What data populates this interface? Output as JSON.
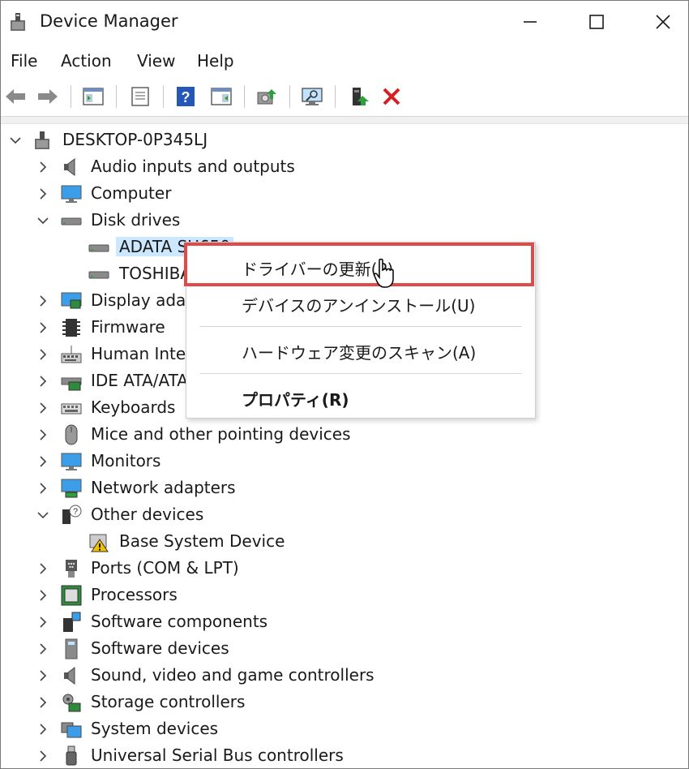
{
  "window": {
    "title": "Device Manager"
  },
  "menu": [
    "File",
    "Action",
    "View",
    "Help"
  ],
  "toolbar": [
    "back-arrow-icon",
    "forward-arrow-icon",
    "show-hide-console-tree-icon",
    "properties-icon",
    "help-icon",
    "action-pane-icon",
    "update-driver-icon",
    "scan-hardware-icon",
    "enable-device-icon",
    "uninstall-device-icon"
  ],
  "tree": {
    "root": "DESKTOP-0P345LJ",
    "items": [
      {
        "label": "Audio inputs and outputs",
        "expanded": false,
        "icon": "speaker-icon"
      },
      {
        "label": "Computer",
        "expanded": false,
        "icon": "monitor-icon"
      },
      {
        "label": "Disk drives",
        "expanded": true,
        "icon": "disk-drive-icon"
      },
      {
        "label": "ADATA SU650",
        "child": true,
        "selected": true,
        "icon": "disk-drive-icon"
      },
      {
        "label": "TOSHIBA",
        "child": true,
        "icon": "disk-drive-icon"
      },
      {
        "label": "Display adapters",
        "expanded": false,
        "icon": "display-adapter-icon"
      },
      {
        "label": "Firmware",
        "expanded": false,
        "icon": "firmware-chip-icon"
      },
      {
        "label": "Human Interface Devices",
        "expanded": false,
        "icon": "keyboard-hid-icon"
      },
      {
        "label": "IDE ATA/ATAPI controllers",
        "expanded": false,
        "icon": "ide-controller-icon"
      },
      {
        "label": "Keyboards",
        "expanded": false,
        "icon": "keyboard-icon"
      },
      {
        "label": "Mice and other pointing devices",
        "expanded": false,
        "icon": "mouse-icon"
      },
      {
        "label": "Monitors",
        "expanded": false,
        "icon": "monitor-icon"
      },
      {
        "label": "Network adapters",
        "expanded": false,
        "icon": "network-adapter-icon"
      },
      {
        "label": "Other devices",
        "expanded": true,
        "icon": "unknown-device-icon"
      },
      {
        "label": "Base System Device",
        "child": true,
        "icon": "warning-device-icon"
      },
      {
        "label": "Ports (COM & LPT)",
        "expanded": false,
        "icon": "port-icon"
      },
      {
        "label": "Processors",
        "expanded": false,
        "icon": "processor-icon"
      },
      {
        "label": "Software components",
        "expanded": false,
        "icon": "software-component-icon"
      },
      {
        "label": "Software devices",
        "expanded": false,
        "icon": "software-device-icon"
      },
      {
        "label": "Sound, video and game controllers",
        "expanded": false,
        "icon": "speaker-icon"
      },
      {
        "label": "Storage controllers",
        "expanded": false,
        "icon": "storage-controller-icon"
      },
      {
        "label": "System devices",
        "expanded": false,
        "icon": "system-device-icon"
      },
      {
        "label": "Universal Serial Bus controllers",
        "expanded": false,
        "icon": "usb-icon"
      }
    ]
  },
  "context_menu": {
    "items": [
      {
        "label": "ドライバーの更新(P)",
        "highlighted": true
      },
      {
        "label": "デバイスのアンインストール(U)"
      },
      {
        "label": "ハードウェア変更のスキャン(A)"
      },
      {
        "label": "プロパティ(R)",
        "bold": true
      }
    ]
  },
  "colors": {
    "selection": "#cce8ff",
    "highlight_box": "#e04a48",
    "uninstall_x": "#d42020",
    "accent_green": "#2e9e3e"
  }
}
